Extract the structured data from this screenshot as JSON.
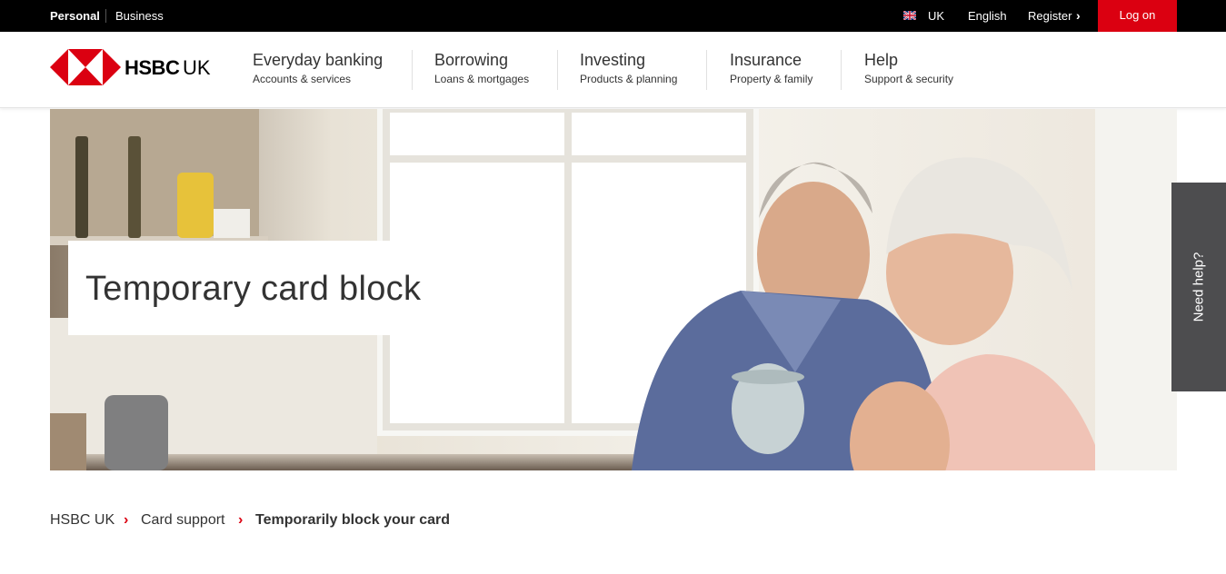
{
  "topbar": {
    "personal": "Personal",
    "business": "Business",
    "region": "UK",
    "language": "English",
    "register": "Register",
    "logon": "Log on"
  },
  "brand": {
    "name": "HSBC",
    "suffix": "UK",
    "accent_color": "#db0011"
  },
  "nav": [
    {
      "title": "Everyday banking",
      "subtitle": "Accounts & services"
    },
    {
      "title": "Borrowing",
      "subtitle": "Loans & mortgages"
    },
    {
      "title": "Investing",
      "subtitle": "Products & planning"
    },
    {
      "title": "Insurance",
      "subtitle": "Property & family"
    },
    {
      "title": "Help",
      "subtitle": "Support & security"
    }
  ],
  "hero": {
    "title": "Temporary card block"
  },
  "side_tab": {
    "label": "Need help?"
  },
  "breadcrumb": [
    "HSBC UK",
    "Card support",
    "Temporarily block your card"
  ],
  "icons": {
    "flag": "uk-flag-icon",
    "chevron": "chevron-right-icon",
    "logo": "hsbc-hexagon-logo"
  }
}
